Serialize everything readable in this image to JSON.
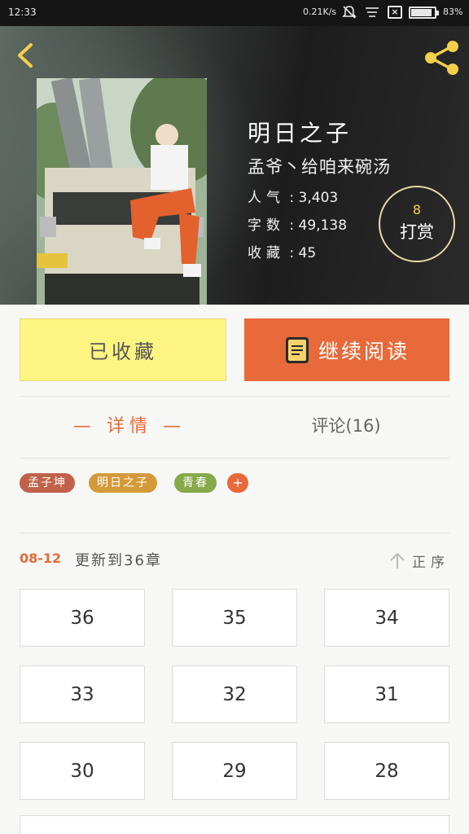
{
  "status_bar": {
    "time": "12:33",
    "net_speed": "0.21K/s",
    "battery_percent": "83%",
    "battery_level": 0.83
  },
  "book": {
    "title": "明日之子",
    "author": "孟爷丶给咱来碗汤",
    "popularity_label": "人气",
    "popularity": "3,403",
    "words_label": "字数",
    "words": "49,138",
    "favorites_label": "收藏",
    "favorites": "45"
  },
  "reward": {
    "count": "8",
    "label": "打赏"
  },
  "actions": {
    "collected_label": "已收藏",
    "continue_label": "继续阅读"
  },
  "tabs": {
    "detail": "— 详情 —",
    "comments": "评论(16)"
  },
  "tags": [
    "孟子坤",
    "明日之子",
    "青春"
  ],
  "tag_add": "+",
  "tag_colors": [
    "#c0624a",
    "#d49a3a",
    "#86a94a"
  ],
  "update": {
    "date": "08-12",
    "text": "更新到36章",
    "sort_label": "正序"
  },
  "chapters": [
    "36",
    "35",
    "34",
    "33",
    "32",
    "31",
    "30",
    "29",
    "28"
  ],
  "colors": {
    "accent": "#e86a3a",
    "collected_bg": "#fdf481",
    "reward_count": "#f4d04a"
  },
  "icons": {
    "back": "chevron-left-icon",
    "share": "share-icon",
    "continue": "book-icon",
    "sort": "arrow-up-icon"
  }
}
